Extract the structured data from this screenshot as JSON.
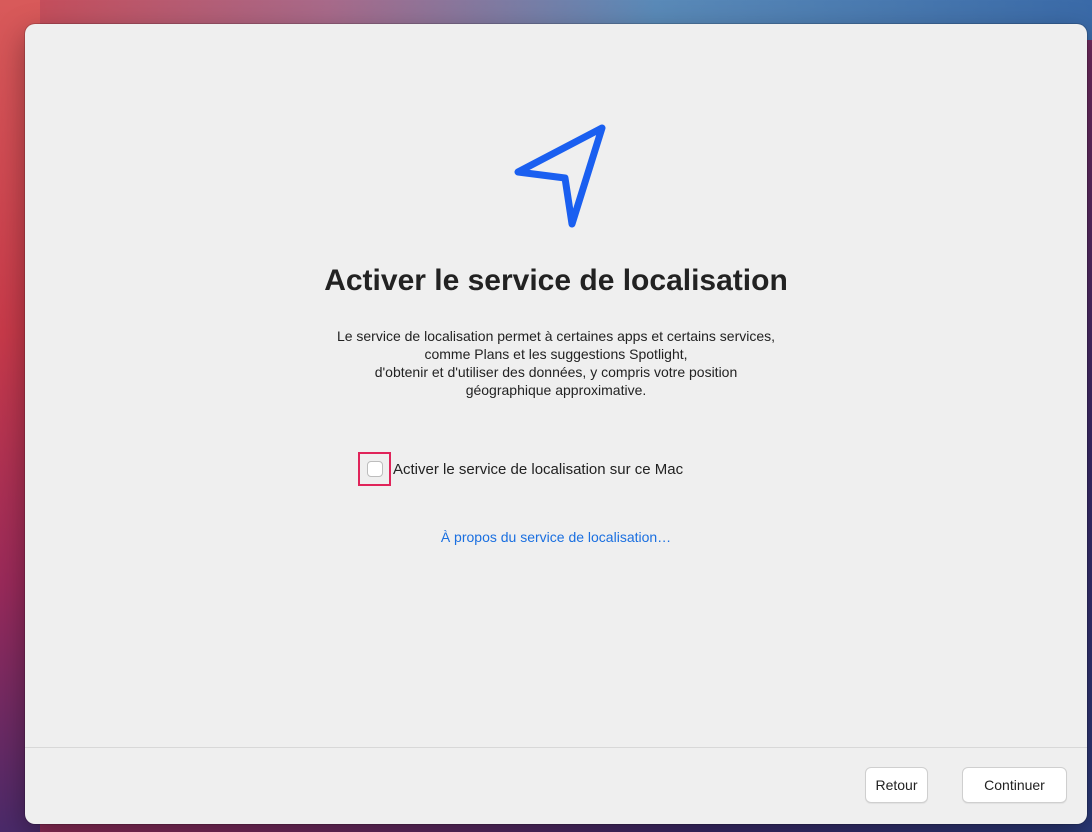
{
  "dialog": {
    "title": "Activer le service de localisation",
    "description_lines": [
      "Le service de localisation permet à certaines apps et certains services,",
      "comme Plans et les suggestions Spotlight,",
      "d'obtenir et d'utiliser des données, y compris votre position",
      "géographique approximative."
    ],
    "checkbox": {
      "label": "Activer le service de localisation sur ce Mac",
      "checked": false
    },
    "about_link": "À propos du service de localisation…",
    "icon": "location-arrow-icon"
  },
  "footer": {
    "back_label": "Retour",
    "continue_label": "Continuer"
  },
  "colors": {
    "accent": "#1a6fe0",
    "icon": "#1a5ff0",
    "highlight": "#e0245a",
    "window_bg": "#efefef"
  }
}
